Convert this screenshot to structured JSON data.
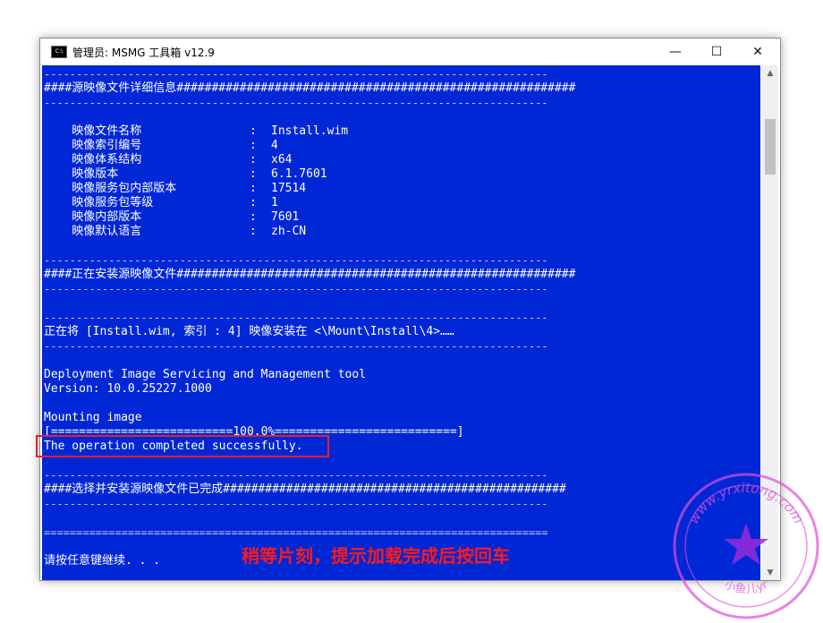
{
  "window": {
    "title": "管理员:  MSMG 工具箱 v12.9",
    "icon_label": "C:\\",
    "minimize_glyph": "—",
    "maximize_glyph": "☐",
    "close_glyph": "✕"
  },
  "console": {
    "dash_line": "------------------------------------------------------------------------------",
    "eq_line": "==============================================================================",
    "section_details": "####源映像文件详细信息#########################################################",
    "details": [
      {
        "label": "    映像文件名称",
        "sep": ":",
        "value": "Install.wim"
      },
      {
        "label": "    映像索引编号",
        "sep": ":",
        "value": "4"
      },
      {
        "label": "    映像体系结构",
        "sep": ":",
        "value": "x64"
      },
      {
        "label": "    映像版本",
        "sep": ":",
        "value": "6.1.7601"
      },
      {
        "label": "    映像服务包内部版本",
        "sep": ":",
        "value": "17514"
      },
      {
        "label": "    映像服务包等级",
        "sep": ":",
        "value": "1"
      },
      {
        "label": "    映像内部版本",
        "sep": ":",
        "value": "7601"
      },
      {
        "label": "    映像默认语言",
        "sep": ":",
        "value": "zh-CN"
      }
    ],
    "section_installing": "####正在安装源映像文件#########################################################",
    "install_msg": "正在将 [Install.wim, 索引 : 4] 映像安装在 <\\Mount\\Install\\4>……",
    "dism_name": "Deployment Image Servicing and Management tool",
    "dism_version": "Version: 10.0.25227.1000",
    "mounting": "Mounting image",
    "progress": "[==========================100.0%==========================]",
    "success": "The operation completed successfully.",
    "section_done": "####选择并安装源映像文件已完成#################################################",
    "press_key": "请按任意键继续. . ."
  },
  "annotation": "稍等片刻，提示加载完成后按回车",
  "watermark": {
    "top_text": "www.yrxitong.com",
    "bottom_text": "小鱼儿yr"
  },
  "colors": {
    "console_bg": "#0027d6",
    "highlight": "#e8202a",
    "annotation": "#ff1a1a",
    "watermark": "#e04fd8"
  }
}
